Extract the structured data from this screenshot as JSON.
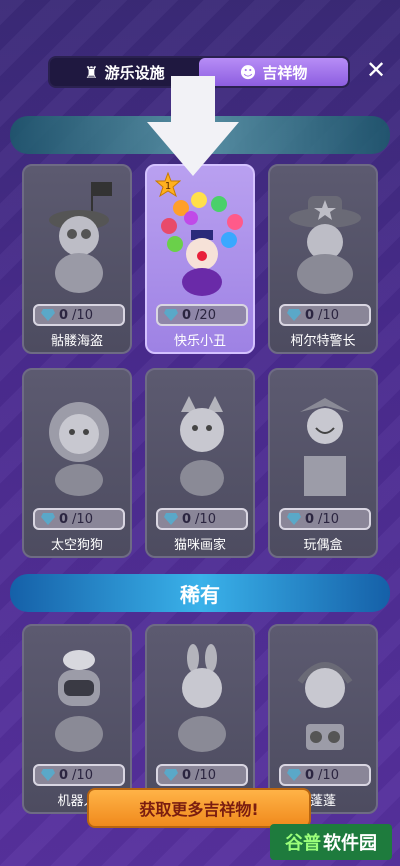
{
  "tabs": [
    {
      "label": "游乐设施",
      "icon": "ferris-wheel-icon",
      "active": false
    },
    {
      "label": "吉祥物",
      "icon": "clown-icon",
      "active": true
    }
  ],
  "close_label": "✕",
  "section_rare": "稀有",
  "cards_row1": [
    {
      "name": "骷髅海盗",
      "count": "0",
      "total": "/10"
    },
    {
      "name": "快乐小丑",
      "count": "0",
      "total": "/20",
      "badge": "1"
    },
    {
      "name": "柯尔特警长",
      "count": "0",
      "total": "/10"
    }
  ],
  "cards_row2": [
    {
      "name": "太空狗狗",
      "count": "0",
      "total": "/10"
    },
    {
      "name": "猫咪画家",
      "count": "0",
      "total": "/10"
    },
    {
      "name": "玩偶盒",
      "count": "0",
      "total": "/10"
    }
  ],
  "cards_row3": [
    {
      "name": "机器人",
      "count": "0",
      "total": "/10"
    },
    {
      "name": "",
      "count": "0",
      "total": "/10"
    },
    {
      "name": "蓬蓬",
      "count": "0",
      "total": "/10"
    }
  ],
  "cta_label": "获取更多吉祥物!",
  "watermark": {
    "part1": "谷普",
    "part2": "软件园"
  }
}
